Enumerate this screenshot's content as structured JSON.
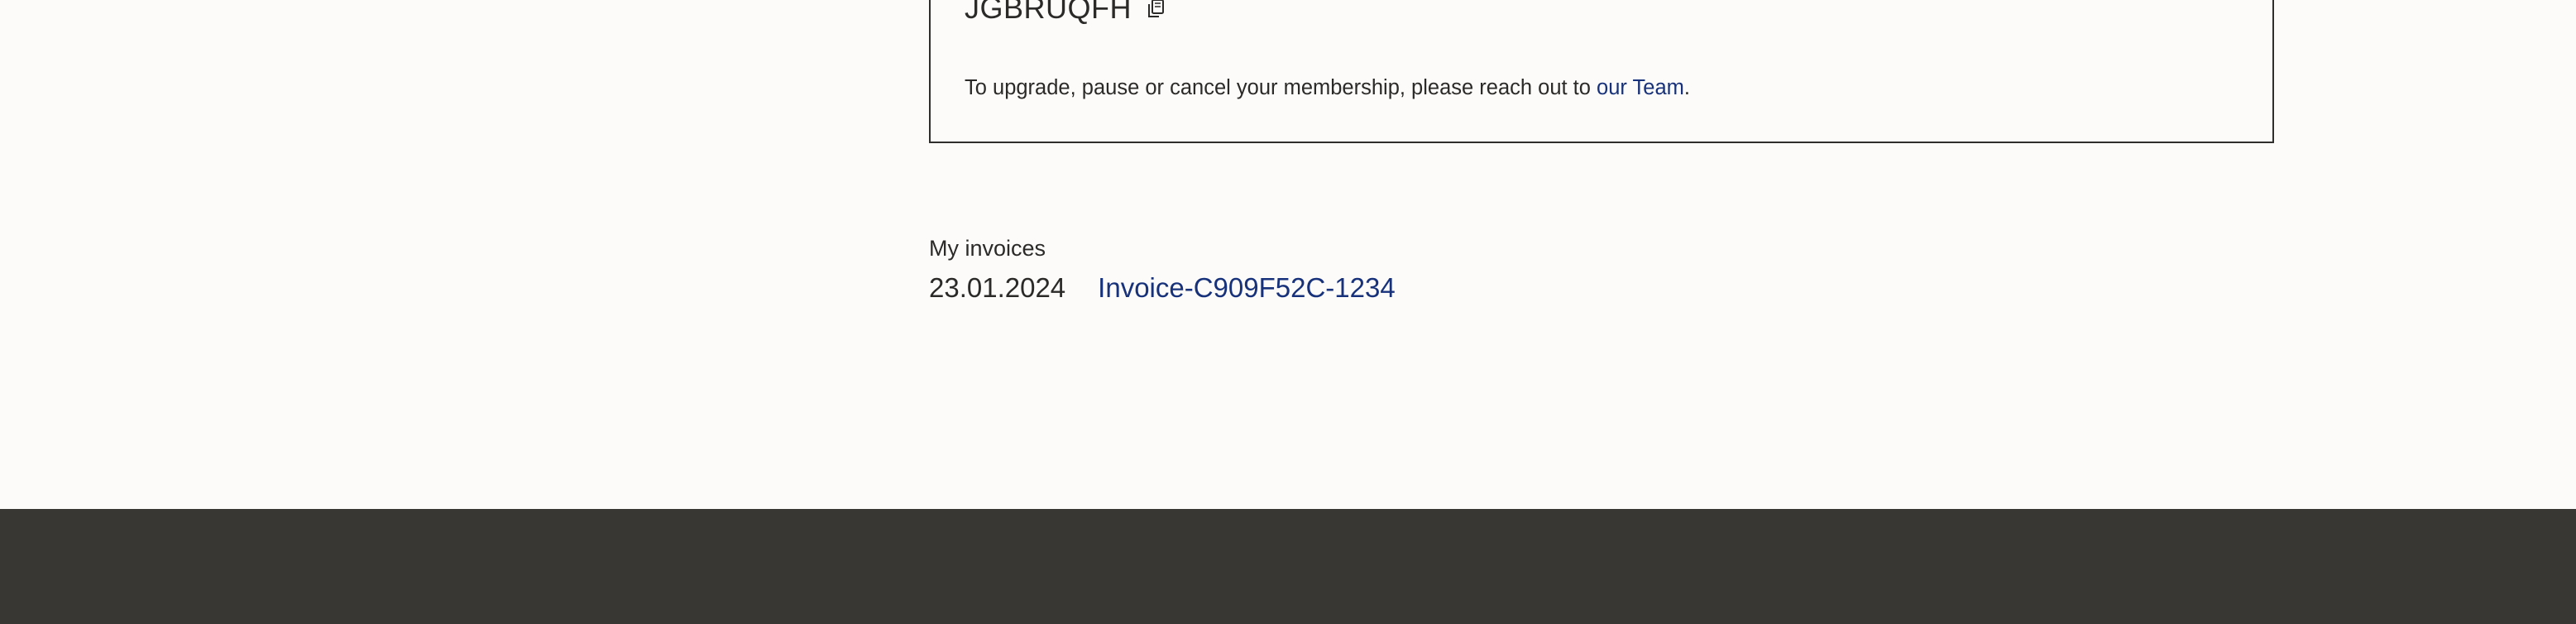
{
  "membership": {
    "member_code": "JGBRUQFH",
    "upgrade_text_prefix": "To upgrade, pause or cancel your membership, please reach out to ",
    "team_link_text": "our Team",
    "upgrade_text_suffix": "."
  },
  "invoices": {
    "title": "My invoices",
    "items": [
      {
        "date": "23.01.2024",
        "name": "Invoice-C909F52C-1234"
      }
    ]
  },
  "icons": {
    "copy": "copy-icon"
  },
  "colors": {
    "page_background": "#fcfbf9",
    "text": "#2b2a28",
    "link": "#17327a",
    "footer": "#393734",
    "border": "#2f2e2c"
  }
}
